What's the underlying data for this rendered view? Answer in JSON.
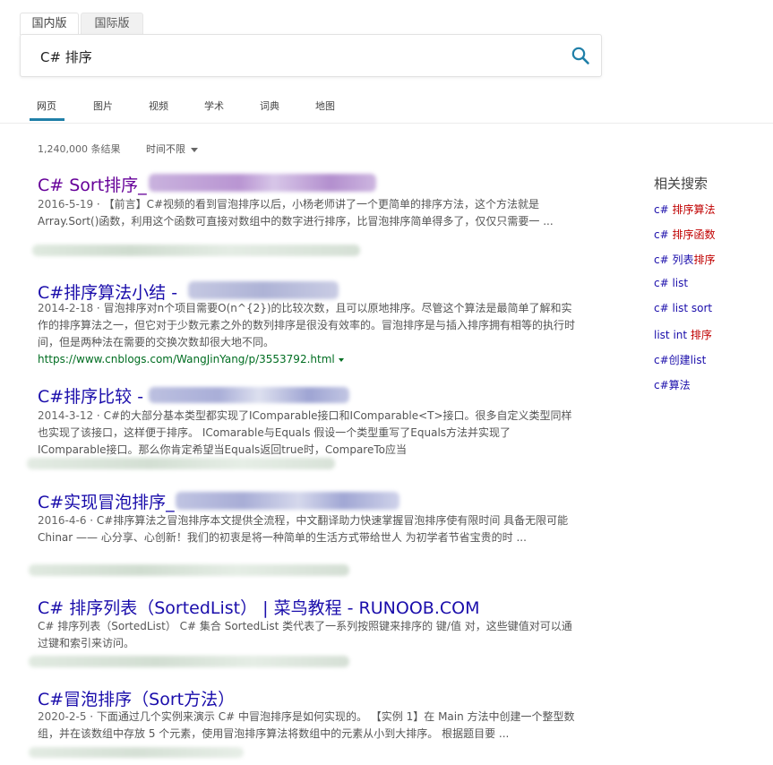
{
  "version_tabs": {
    "domestic": "国内版",
    "international": "国际版"
  },
  "search": {
    "query": "C# 排序"
  },
  "nav_tabs": [
    "网页",
    "图片",
    "视频",
    "学术",
    "词典",
    "地图"
  ],
  "results_meta": {
    "count": "1,240,000 条结果",
    "time_filter": "时间不限"
  },
  "results": [
    {
      "title": "C# Sort排序_",
      "date": "2016-5-19",
      "snippet": "【前言】C#视频的看到冒泡排序以后，小杨老师讲了一个更简单的排序方法，这个方法就是Array.Sort()函数，利用这个函数可直接对数组中的数字进行排序，比冒泡排序简单得多了，仅仅只需要一 ..."
    },
    {
      "title": "C#排序算法小结 -",
      "date": "2014-2-18",
      "snippet": "冒泡排序对n个项目需要O(n^{2})的比较次数，且可以原地排序。尽管这个算法是最简单了解和实作的排序算法之一，但它对于少数元素之外的数列排序是很没有效率的。冒泡排序是与插入排序拥有相等的执行时间，但是两种法在需要的交换次数却很大地不同。",
      "url": "https://www.cnblogs.com/WangJinYang/p/3553792.html"
    },
    {
      "title": "C#排序比较 -",
      "date": "2014-3-12",
      "snippet": "C#的大部分基本类型都实现了IComparable接口和IComparable<T>接口。很多自定义类型同样也实现了该接口，这样便于排序。 IComarable与Equals 假设一个类型重写了Equals方法并实现了IComparable接口。那么你肯定希望当Equals返回true时，CompareTo应当"
    },
    {
      "title": "C#实现冒泡排序_",
      "date": "2016-4-6",
      "snippet": "C#排序算法之冒泡排序本文提供全流程，中文翻译助力快速掌握冒泡排序使有限时间 具备无限可能Chinar —— 心分享、心创新！我们的初衷是将一种简单的生活方式带给世人 为初学者节省宝贵的时 ..."
    },
    {
      "title": "C# 排序列表（SortedList） | 菜鸟教程 - RUNOOB.COM",
      "snippet": "C# 排序列表（SortedList） C# 集合 SortedList 类代表了一系列按照键来排序的 键/值 对，这些键值对可以通过键和索引来访问。"
    },
    {
      "title": "C#冒泡排序（Sort方法）",
      "date": "2020-2-5",
      "snippet": "下面通过几个实例来演示 C# 中冒泡排序是如何实现的。 【实例 1】在 Main 方法中创建一个整型数组，并在该数组中存放 5 个元素，使用冒泡排序算法将数组中的元素从小到大排序。 根据题目要 ..."
    }
  ],
  "related": {
    "heading": "相关搜索",
    "items": [
      {
        "plain": "c# ",
        "hl": "排序算法"
      },
      {
        "plain": "c# ",
        "hl": "排序函数"
      },
      {
        "plain": "c# 列表",
        "hl": "排序"
      },
      {
        "plain": "c# list",
        "hl": ""
      },
      {
        "plain": "c# list sort",
        "hl": ""
      },
      {
        "plain": "list int ",
        "hl": "排序"
      },
      {
        "plain": "c#创建list",
        "hl": ""
      },
      {
        "plain": "c#算法",
        "hl": ""
      }
    ]
  },
  "colors": {
    "link": "#1a0dab",
    "visited_link": "#660099",
    "url_green": "#006d21",
    "highlight_red": "#c00000",
    "accent_underline": "#1f7fa8",
    "search_icon": "#1f7fa8"
  }
}
